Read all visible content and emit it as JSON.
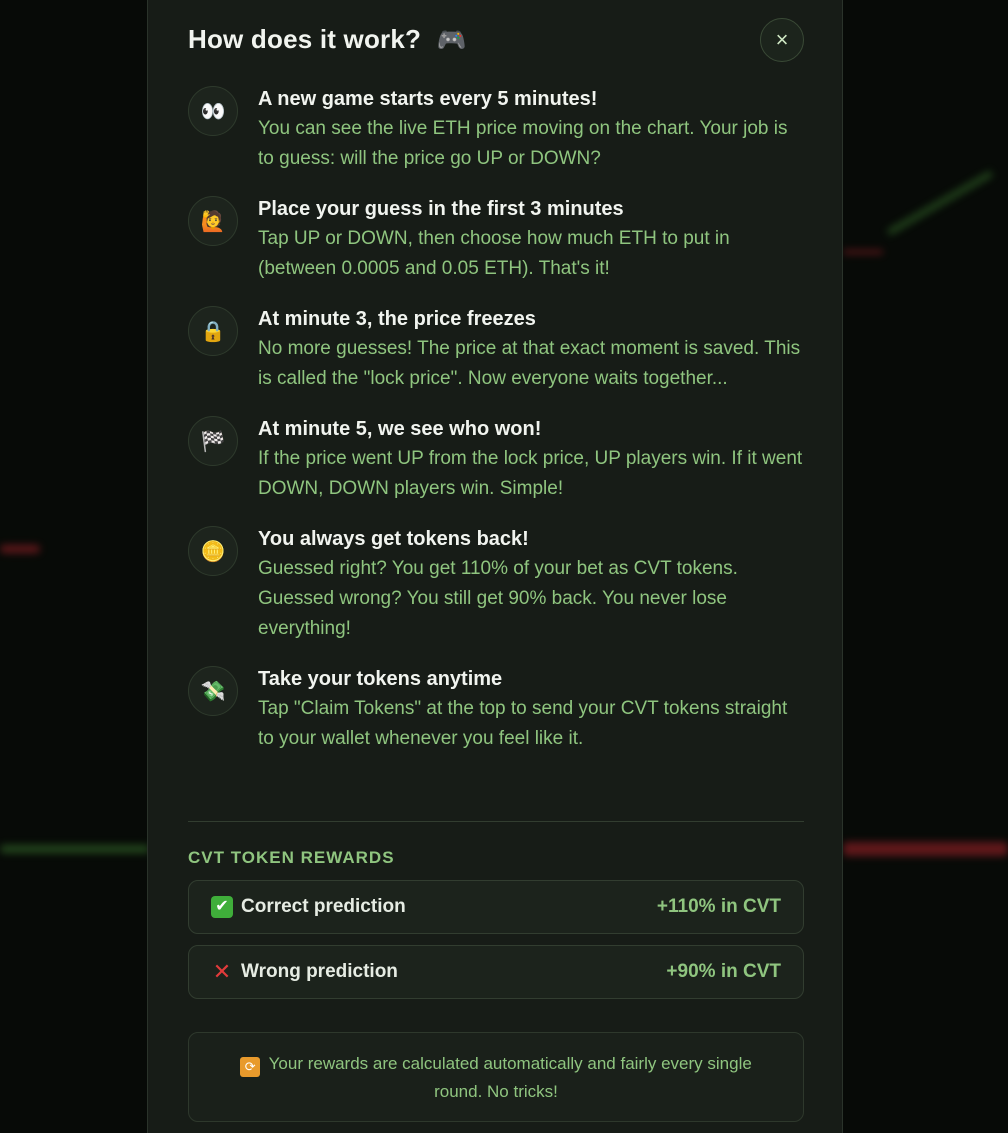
{
  "modal": {
    "title": "How does it work?",
    "title_icon": "game-controller-icon",
    "close_label": "×"
  },
  "steps": [
    {
      "icon": "eyes-icon",
      "glyph": "👀",
      "title": "A new game starts every 5 minutes!",
      "text": "You can see the live ETH price moving on the chart. Your job is to guess: will the price go UP or DOWN?"
    },
    {
      "icon": "raising-hand-icon",
      "glyph": "🙋",
      "title": "Place your guess in the first 3 minutes",
      "text": "Tap UP or DOWN, then choose how much ETH to put in (between 0.0005 and 0.05 ETH). That's it!"
    },
    {
      "icon": "lock-icon",
      "glyph": "🔒",
      "title": "At minute 3, the price freezes",
      "text": "No more guesses! The price at that exact moment is saved. This is called the \"lock price\". Now everyone waits together..."
    },
    {
      "icon": "checkered-flag-icon",
      "glyph": "🏁",
      "title": "At minute 5, we see who won!",
      "text": "If the price went UP from the lock price, UP players win. If it went DOWN, DOWN players win. Simple!"
    },
    {
      "icon": "coin-icon",
      "glyph": "🪙",
      "title": "You always get tokens back!",
      "text": "Guessed right? You get 110% of your bet as CVT tokens. Guessed wrong? You still get 90% back. You never lose everything!"
    },
    {
      "icon": "money-with-wings-icon",
      "glyph": "💸",
      "title": "Take your tokens anytime",
      "text": "Tap \"Claim Tokens\" at the top to send your CVT tokens straight to your wallet whenever you feel like it."
    }
  ],
  "rewards": {
    "heading": "CVT TOKEN REWARDS",
    "correct": {
      "icon": "check-mark-icon",
      "label": "Correct prediction",
      "value": "+110% in CVT"
    },
    "wrong": {
      "icon": "cross-mark-icon",
      "label": "Wrong prediction",
      "value": "+90% in CVT"
    }
  },
  "note": {
    "icon": "repeat-icon",
    "text": "Your rewards are calculated automatically and fairly every single round. No tricks!"
  },
  "colors": {
    "accent_green": "#8fc57f",
    "modal_bg": "#171c17",
    "wrong_red": "#e23b3b"
  }
}
